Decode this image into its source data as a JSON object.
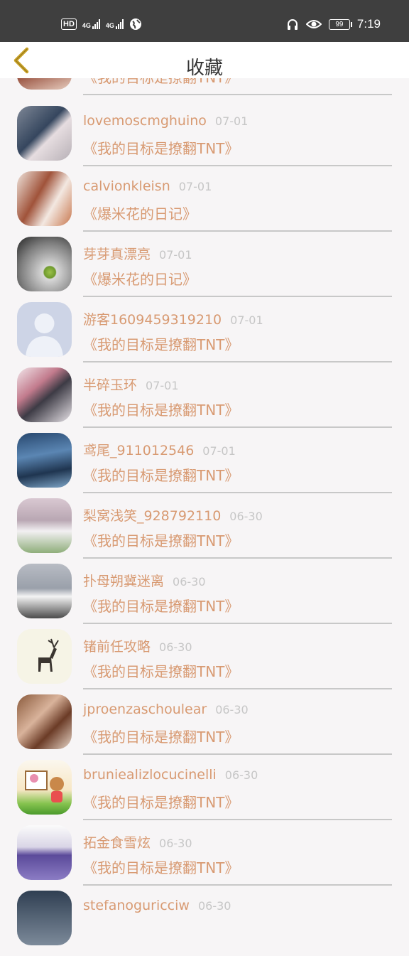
{
  "status_bar": {
    "hd": "HD",
    "signal1_label": "4G",
    "signal2_label": "4G",
    "battery": "99",
    "time": "7:19"
  },
  "header": {
    "title": "收藏"
  },
  "colors": {
    "accent": "#d89a72",
    "date": "#c6c6c6",
    "back": "#c9a227"
  },
  "items": [
    {
      "name": "",
      "date": "",
      "book": "《我的目标是撩翻TNT》"
    },
    {
      "name": "lovemoscmghuino",
      "date": "07-01",
      "book": "《我的目标是撩翻TNT》"
    },
    {
      "name": "calvionkleisn",
      "date": "07-01",
      "book": "《爆米花的日记》"
    },
    {
      "name": "芽芽真漂亮",
      "date": "07-01",
      "book": "《爆米花的日记》"
    },
    {
      "name": "游客1609459319210",
      "date": "07-01",
      "book": "《我的目标是撩翻TNT》"
    },
    {
      "name": "半碎玉环",
      "date": "07-01",
      "book": "《我的目标是撩翻TNT》"
    },
    {
      "name": "鸢尾_911012546",
      "date": "07-01",
      "book": "《我的目标是撩翻TNT》"
    },
    {
      "name": "梨窝浅笑_928792110",
      "date": "06-30",
      "book": "《我的目标是撩翻TNT》"
    },
    {
      "name": "扑母朔冀迷离",
      "date": "06-30",
      "book": "《我的目标是撩翻TNT》"
    },
    {
      "name": "锗前任攻略",
      "date": "06-30",
      "book": "《我的目标是撩翻TNT》"
    },
    {
      "name": "jproenzaschoulear",
      "date": "06-30",
      "book": "《我的目标是撩翻TNT》"
    },
    {
      "name": "bruniealizlocucinelli",
      "date": "06-30",
      "book": "《我的目标是撩翻TNT》"
    },
    {
      "name": "拓金食雪炫",
      "date": "06-30",
      "book": "《我的目标是撩翻TNT》"
    },
    {
      "name": "stefanoguricciw",
      "date": "06-30",
      "book": ""
    }
  ]
}
